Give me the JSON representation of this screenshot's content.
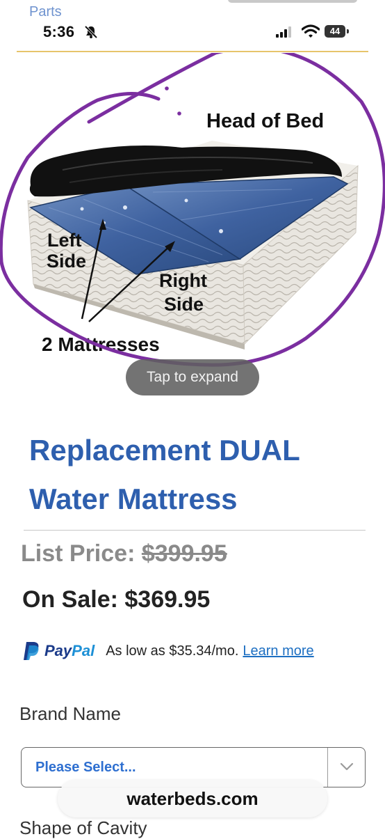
{
  "status_bar": {
    "back_label": "Parts",
    "time": "5:36",
    "battery": "44"
  },
  "product_image": {
    "labels": {
      "head": "Head of Bed",
      "left_line1": "Left",
      "left_line2": "Side",
      "right_line1": "Right",
      "right_line2": "Side",
      "count": "2 Mattresses"
    },
    "expand_hint": "Tap to expand",
    "annotation_color": "#7b2ea0"
  },
  "product": {
    "title": "Replacement DUAL Water Mattress",
    "list_price_label": "List Price: ",
    "list_price_value": "$399.95",
    "sale_price": "On Sale: $369.95"
  },
  "paypal": {
    "brand_pay": "Pay",
    "brand_pal": "Pal",
    "message": "As low as $35.34/mo.",
    "link": "Learn more"
  },
  "options": {
    "brand_label": "Brand Name",
    "brand_value": "Please Select...",
    "shape_label": "Shape of Cavity"
  },
  "browser": {
    "url": "waterbeds.com"
  },
  "colors": {
    "title": "#2e5fae",
    "accent_rule": "#e7c56b",
    "paypal_dark": "#1b3b8a",
    "paypal_light": "#1d90d6",
    "mattress_blue": "#3d5f97"
  }
}
